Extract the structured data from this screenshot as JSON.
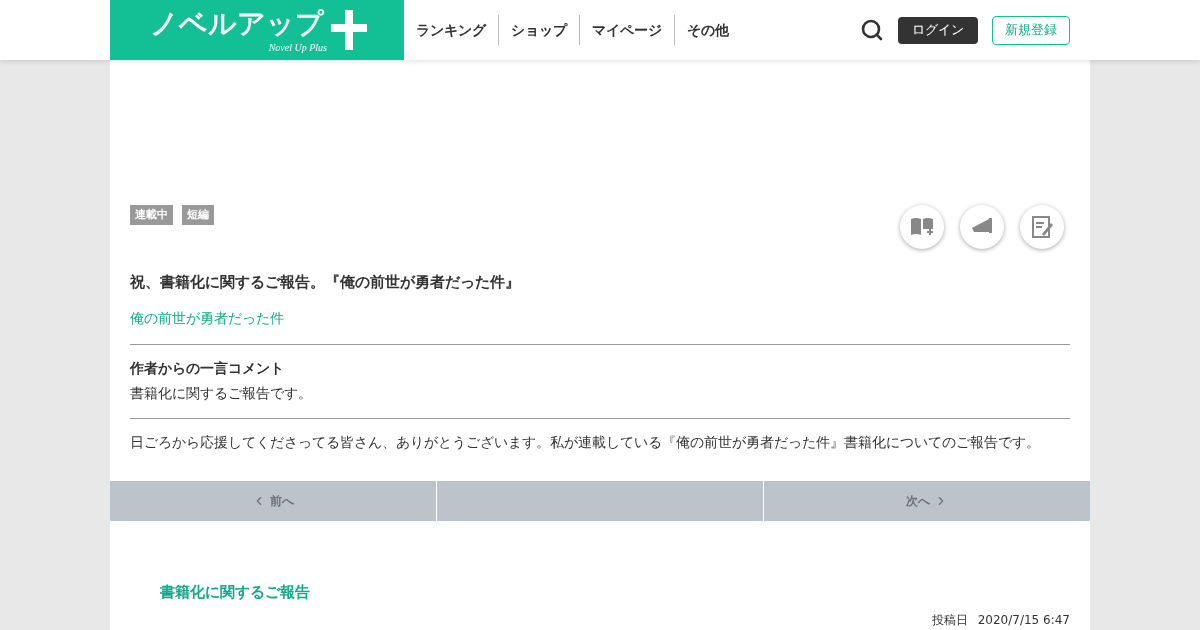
{
  "logo": {
    "title": "ノベルアップ",
    "subtitle": "Novel Up Plus"
  },
  "nav": [
    "ランキング",
    "ショップ",
    "マイページ",
    "その他"
  ],
  "header_buttons": {
    "login": "ログイン",
    "register": "新規登録"
  },
  "tags": [
    "連載中",
    "短編"
  ],
  "title": "祝、書籍化に関するご報告。『俺の前世が勇者だった件』",
  "series_link": "俺の前世が勇者だった件",
  "comment": {
    "heading": "作者からの一言コメント",
    "text": "書籍化に関するご報告です。"
  },
  "summary": "日ごろから応援してくださってる皆さん、ありがとうございます。私が連載している『俺の前世が勇者だった件』書籍化についてのご報告です。",
  "pager": {
    "prev": {
      "label": "前へ",
      "disabled": true
    },
    "next": {
      "label": "次へ",
      "disabled": true
    }
  },
  "episode": {
    "title": "書籍化に関するご報告",
    "date_label": "投稿日",
    "date": "2020/7/15 6:47"
  }
}
